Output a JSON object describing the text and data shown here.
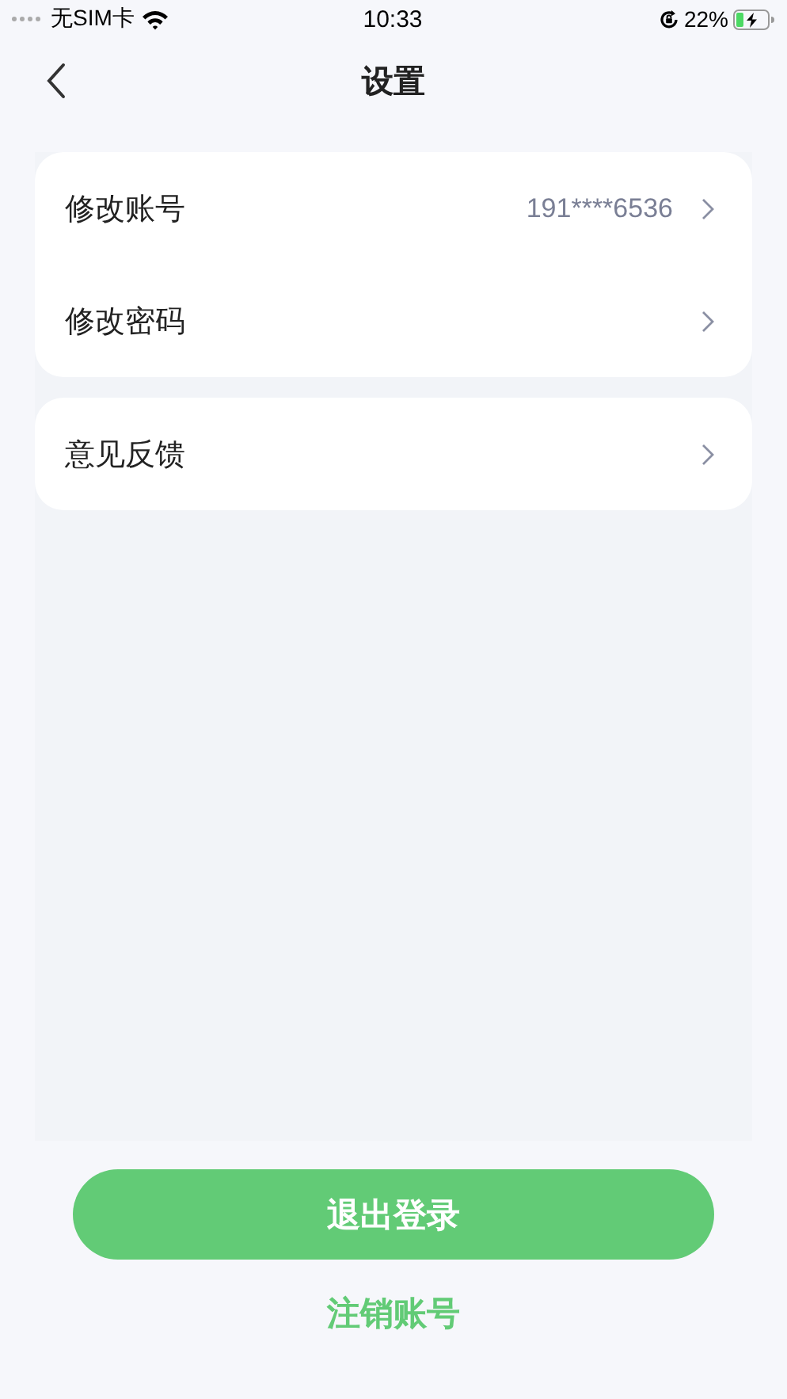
{
  "status_bar": {
    "carrier": "无SIM卡",
    "time": "10:33",
    "battery": "22%",
    "charging": true
  },
  "nav": {
    "title": "设置"
  },
  "groups": [
    {
      "items": [
        {
          "label": "修改账号",
          "value": "191****6536"
        },
        {
          "label": "修改密码"
        }
      ]
    },
    {
      "items": [
        {
          "label": "意见反馈"
        }
      ]
    }
  ],
  "buttons": [
    {
      "kind": "primary",
      "label": "退出登录"
    },
    {
      "kind": "link",
      "label": "注销账号"
    }
  ]
}
